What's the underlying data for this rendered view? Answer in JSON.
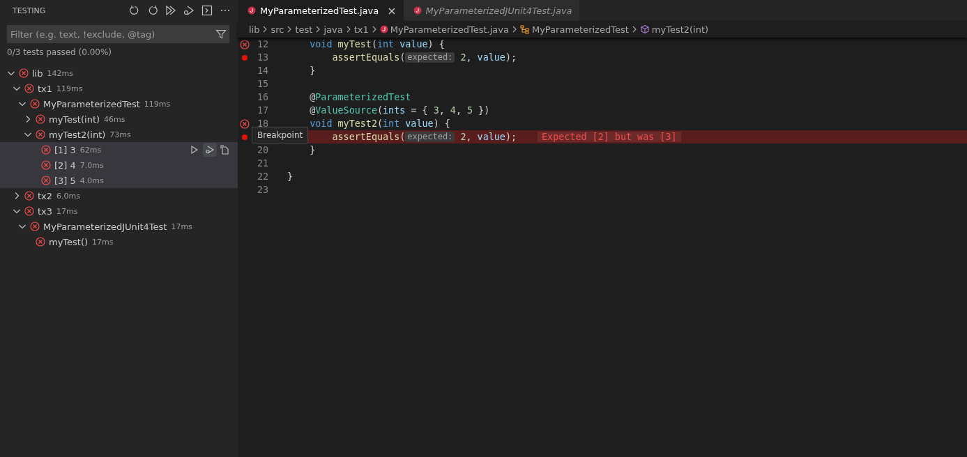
{
  "sidebar": {
    "title": "TESTING",
    "actions": [
      {
        "kind": "refresh"
      },
      {
        "kind": "rerun"
      },
      {
        "kind": "run"
      },
      {
        "kind": "debug"
      },
      {
        "kind": "output"
      },
      {
        "kind": "more"
      }
    ],
    "filter": {
      "placeholder": "Filter (e.g. text, !exclude, @tag)"
    },
    "summary": "0/3 tests passed (0.00%)",
    "tree": [
      {
        "name": "lib",
        "duration": "142ms",
        "failed": true,
        "expanded": true,
        "selected": false,
        "children": [
          {
            "name": "tx1",
            "duration": "119ms",
            "failed": true,
            "expanded": true,
            "selected": false,
            "children": [
              {
                "name": "MyParameterizedTest",
                "duration": "119ms",
                "failed": true,
                "expanded": true,
                "selected": false,
                "children": [
                  {
                    "name": "myTest(int)",
                    "duration": "46ms",
                    "failed": true,
                    "expanded": false,
                    "selected": false
                  },
                  {
                    "name": "myTest2(int)",
                    "duration": "73ms",
                    "failed": true,
                    "expanded": true,
                    "selected": false,
                    "children": [
                      {
                        "name": "[1] 3",
                        "duration": "62ms",
                        "failed": true,
                        "selected": true,
                        "hovered": true
                      },
                      {
                        "name": "[2] 4",
                        "duration": "7.0ms",
                        "failed": true,
                        "selected": true,
                        "hovered": false
                      },
                      {
                        "name": "[3] 5",
                        "duration": "4.0ms",
                        "failed": true,
                        "selected": true,
                        "hovered": false
                      }
                    ]
                  }
                ]
              }
            ]
          },
          {
            "name": "tx2",
            "duration": "6.0ms",
            "failed": true,
            "expanded": false,
            "selected": false
          },
          {
            "name": "tx3",
            "duration": "17ms",
            "failed": true,
            "expanded": true,
            "selected": false,
            "children": [
              {
                "name": "MyParameterizedJUnit4Test",
                "duration": "17ms",
                "failed": true,
                "expanded": true,
                "selected": false,
                "children": [
                  {
                    "name": "myTest()",
                    "duration": "17ms",
                    "failed": true,
                    "selected": false
                  }
                ]
              }
            ]
          }
        ]
      }
    ]
  },
  "tabs": [
    {
      "label": "MyParameterizedTest.java",
      "selected": true,
      "close": "×"
    },
    {
      "label": "MyParameterizedJUnit4Test.java",
      "selected": false
    }
  ],
  "breadcrumbs": [
    {
      "kind": "folder",
      "label": "lib"
    },
    {
      "kind": "folder",
      "label": "src"
    },
    {
      "kind": "folder",
      "label": "test"
    },
    {
      "kind": "folder",
      "label": "java"
    },
    {
      "kind": "folder",
      "label": "tx1"
    },
    {
      "kind": "file",
      "label": "MyParameterizedTest.java"
    },
    {
      "kind": "class",
      "label": "MyParameterizedTest"
    },
    {
      "kind": "method",
      "label": "myTest2(int)"
    }
  ],
  "lines": [
    {
      "kind": "member",
      "number": "12",
      "error": true,
      "breakpoint": false,
      "highlighted": false,
      "tokens": [
        {
          "kind": "keyword",
          "text": "void"
        },
        {
          "kind": "func",
          "text": " myTest"
        },
        {
          "kind": "plain",
          "text": "("
        },
        {
          "kind": "keyword",
          "text": "int"
        },
        {
          "kind": "param",
          "text": " value"
        },
        {
          "kind": "plain",
          "text": ") {"
        }
      ]
    },
    {
      "kind": "body",
      "number": "13",
      "error": false,
      "breakpoint": true,
      "highlighted": false,
      "tokens": [
        {
          "kind": "func",
          "text": "assertEquals"
        },
        {
          "kind": "plain",
          "text": "("
        },
        {
          "kind": "hint",
          "text": "expected:"
        },
        {
          "kind": "number",
          "text": " 2"
        },
        {
          "kind": "plain",
          "text": ", "
        },
        {
          "kind": "param",
          "text": "value"
        },
        {
          "kind": "plain",
          "text": ");"
        }
      ]
    },
    {
      "kind": "member",
      "number": "14",
      "error": false,
      "breakpoint": false,
      "highlighted": false,
      "tokens": [
        {
          "kind": "plain",
          "text": "}"
        }
      ]
    },
    {
      "kind": "blank",
      "number": "15",
      "error": false,
      "breakpoint": false,
      "highlighted": false
    },
    {
      "kind": "member",
      "number": "16",
      "error": false,
      "breakpoint": false,
      "highlighted": false,
      "tokens": [
        {
          "kind": "plain",
          "text": "@"
        },
        {
          "kind": "type",
          "text": "ParameterizedTest"
        }
      ]
    },
    {
      "kind": "member",
      "number": "17",
      "error": false,
      "breakpoint": false,
      "highlighted": false,
      "tokens": [
        {
          "kind": "plain",
          "text": "@"
        },
        {
          "kind": "type",
          "text": "ValueSource"
        },
        {
          "kind": "plain",
          "text": "("
        },
        {
          "kind": "param",
          "text": "ints"
        },
        {
          "kind": "plain",
          "text": " = { "
        },
        {
          "kind": "number",
          "text": "3"
        },
        {
          "kind": "plain",
          "text": ", "
        },
        {
          "kind": "number",
          "text": "4"
        },
        {
          "kind": "plain",
          "text": ", "
        },
        {
          "kind": "number",
          "text": "5"
        },
        {
          "kind": "plain",
          "text": " })"
        }
      ]
    },
    {
      "kind": "member",
      "number": "18",
      "error": true,
      "breakpoint": false,
      "highlighted": false,
      "tokens": [
        {
          "kind": "keyword",
          "text": "void"
        },
        {
          "kind": "func",
          "text": " myTest2"
        },
        {
          "kind": "plain",
          "text": "("
        },
        {
          "kind": "keyword",
          "text": "int"
        },
        {
          "kind": "param",
          "text": " value"
        },
        {
          "kind": "plain",
          "text": ") {"
        }
      ]
    },
    {
      "kind": "body",
      "error": false,
      "breakpoint": true,
      "highlighted": true,
      "tooltip": "Breakpoint",
      "tokens": [
        {
          "kind": "func",
          "text": "assertEquals"
        },
        {
          "kind": "plain",
          "text": "("
        },
        {
          "kind": "hint",
          "text": "expected:"
        },
        {
          "kind": "number",
          "text": " 2"
        },
        {
          "kind": "plain",
          "text": ", "
        },
        {
          "kind": "param",
          "text": "value"
        },
        {
          "kind": "plain",
          "text": ");"
        }
      ],
      "message": "Expected [2] but was [3]"
    },
    {
      "kind": "member",
      "number": "20",
      "error": false,
      "breakpoint": false,
      "highlighted": false,
      "tokens": [
        {
          "kind": "plain",
          "text": "}"
        }
      ]
    },
    {
      "kind": "blank",
      "number": "21",
      "error": false,
      "breakpoint": false,
      "highlighted": false
    },
    {
      "kind": "top",
      "number": "22",
      "error": false,
      "breakpoint": false,
      "highlighted": false,
      "tokens": [
        {
          "kind": "plain",
          "text": "}"
        }
      ]
    },
    {
      "kind": "blank",
      "number": "23",
      "error": false,
      "breakpoint": false,
      "highlighted": false
    }
  ]
}
